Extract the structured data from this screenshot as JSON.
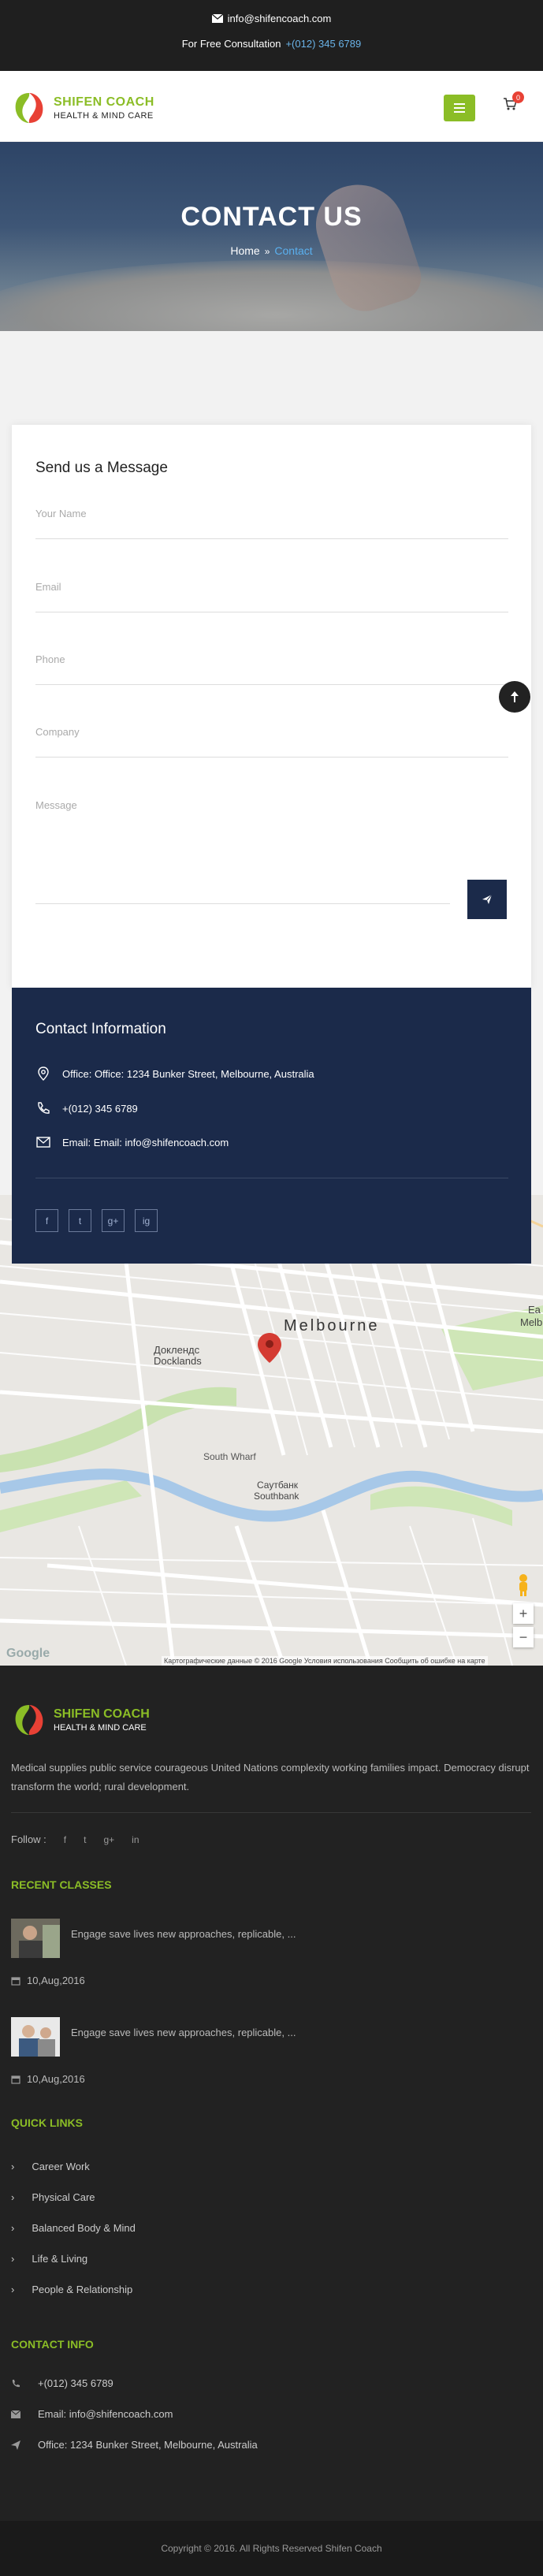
{
  "topbar": {
    "email": "info@shifencoach.com",
    "consult_label": "For Free Consultation",
    "consult_phone": "+(012) 345 6789"
  },
  "brand": {
    "name": "SHIFEN COACH",
    "tagline": "HEALTH & MIND CARE",
    "accent": "#8bbd26",
    "navy": "#1b2a4a"
  },
  "header": {
    "cart_count": "0"
  },
  "hero": {
    "title": "CONTACT US",
    "breadcrumb_home": "Home",
    "breadcrumb_sep": "»",
    "breadcrumb_current": "Contact"
  },
  "form": {
    "title": "Send us a Message",
    "name_placeholder": "Your Name",
    "email_placeholder": "Email",
    "phone_placeholder": "Phone",
    "company_placeholder": "Company",
    "message_placeholder": "Message"
  },
  "contact_info": {
    "title": "Contact Information",
    "office": "Office: Office: 1234 Bunker Street, Melbourne, Australia",
    "phone": "+(012) 345 6789",
    "email": "Email: Email: info@shifencoach.com",
    "socials": [
      "f",
      "t",
      "g+",
      "ig"
    ]
  },
  "map": {
    "city": "Melbourne",
    "docklands_ru": "Доклендс",
    "docklands": "Docklands",
    "south_wharf": "South Wharf",
    "southbank_ru": "Саутбанк",
    "southbank": "Southbank",
    "east": "Ea",
    "east2": "Melb",
    "credit": "Картографические данные © 2016 Google     Условия использования     Сообщить об ошибке на карте",
    "google": "Google",
    "zoom_in": "+",
    "zoom_out": "−"
  },
  "footer": {
    "about": "Medical supplies public service courageous United Nations complexity working families impact. Democracy disrupt transform the world; rural development.",
    "follow_label": "Follow :",
    "recent_title": "RECENT CLASSES",
    "classes": [
      {
        "text": "Engage save lives new approaches, replicable, ...",
        "date": "10,Aug,2016"
      },
      {
        "text": "Engage save lives new approaches, replicable, ...",
        "date": "10,Aug,2016"
      }
    ],
    "quick_title": "QUICK LINKS",
    "quick_links": [
      "Career Work",
      "Physical Care",
      "Balanced Body & Mind",
      "Life & Living",
      "People & Relationship"
    ],
    "contact_title": "CONTACT INFO",
    "contact_phone": "+(012) 345 6789",
    "contact_email": "Email: info@shifencoach.com",
    "contact_office": "Office: 1234 Bunker Street, Melbourne, Australia",
    "copyright": "Copyright © 2016. All Rights Reserved Shifen Coach"
  }
}
